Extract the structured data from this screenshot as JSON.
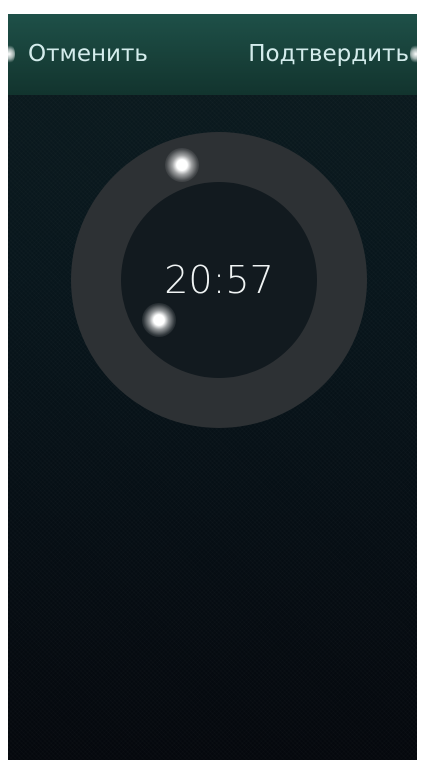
{
  "header": {
    "cancel_label": "Отменить",
    "confirm_label": "Подтвердить"
  },
  "time_picker": {
    "time": "20:57"
  },
  "colors": {
    "header_accent": "#1e5048",
    "background": "#08161c",
    "dial_ring": "#2d3134",
    "text": "#d4ecec"
  }
}
